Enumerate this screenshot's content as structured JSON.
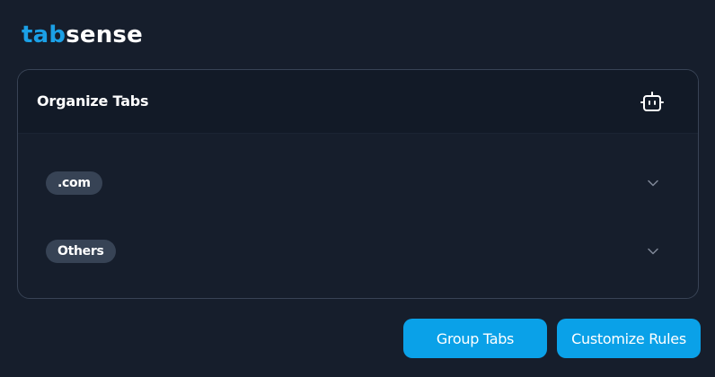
{
  "brand": {
    "accent_text": "tab",
    "rest_text": "sense",
    "accent_color": "#1ba0e6"
  },
  "card": {
    "title": "Organize Tabs",
    "ai_button_icon": "robot-icon"
  },
  "groups": [
    {
      "label": ".com",
      "icon": "chevron-down-icon",
      "expanded": false
    },
    {
      "label": "Others",
      "icon": "chevron-down-icon",
      "expanded": false
    }
  ],
  "actions": {
    "group_tabs_label": "Group Tabs",
    "customize_rules_label": "Customize Rules",
    "button_color": "#0aa1e8"
  }
}
